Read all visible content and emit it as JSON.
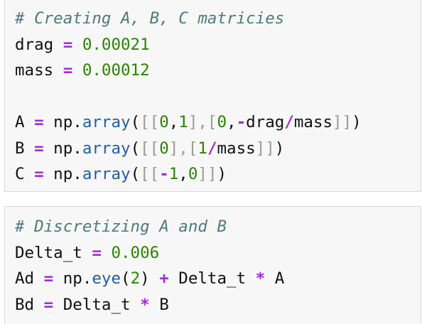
{
  "cells": [
    {
      "lines": [
        [
          {
            "t": "# Creating A, B, C matricies",
            "k": "cm"
          }
        ],
        [
          {
            "t": "drag",
            "k": "tx"
          },
          {
            "t": " ",
            "k": "tx"
          },
          {
            "t": "=",
            "k": "op"
          },
          {
            "t": " ",
            "k": "tx"
          },
          {
            "t": "0.00021",
            "k": "num"
          }
        ],
        [
          {
            "t": "mass",
            "k": "tx"
          },
          {
            "t": " ",
            "k": "tx"
          },
          {
            "t": "=",
            "k": "op"
          },
          {
            "t": " ",
            "k": "tx"
          },
          {
            "t": "0.00012",
            "k": "num"
          }
        ],
        [],
        [
          {
            "t": "A",
            "k": "tx"
          },
          {
            "t": " ",
            "k": "tx"
          },
          {
            "t": "=",
            "k": "op"
          },
          {
            "t": " np.",
            "k": "tx"
          },
          {
            "t": "array",
            "k": "fn"
          },
          {
            "t": "(",
            "k": "tx"
          },
          {
            "t": "[[",
            "k": "br"
          },
          {
            "t": "0",
            "k": "num"
          },
          {
            "t": ",",
            "k": "tx"
          },
          {
            "t": "1",
            "k": "num"
          },
          {
            "t": "],[",
            "k": "br"
          },
          {
            "t": "0",
            "k": "num"
          },
          {
            "t": ",",
            "k": "tx"
          },
          {
            "t": "-",
            "k": "op"
          },
          {
            "t": "drag",
            "k": "tx"
          },
          {
            "t": "/",
            "k": "op"
          },
          {
            "t": "mass",
            "k": "tx"
          },
          {
            "t": "]]",
            "k": "br"
          },
          {
            "t": ")",
            "k": "tx"
          }
        ],
        [
          {
            "t": "B",
            "k": "tx"
          },
          {
            "t": " ",
            "k": "tx"
          },
          {
            "t": "=",
            "k": "op"
          },
          {
            "t": " np.",
            "k": "tx"
          },
          {
            "t": "array",
            "k": "fn"
          },
          {
            "t": "(",
            "k": "tx"
          },
          {
            "t": "[[",
            "k": "br"
          },
          {
            "t": "0",
            "k": "num"
          },
          {
            "t": "],[",
            "k": "br"
          },
          {
            "t": "1",
            "k": "num"
          },
          {
            "t": "/",
            "k": "op"
          },
          {
            "t": "mass",
            "k": "tx"
          },
          {
            "t": "]]",
            "k": "br"
          },
          {
            "t": ")",
            "k": "tx"
          }
        ],
        [
          {
            "t": "C",
            "k": "tx"
          },
          {
            "t": " ",
            "k": "tx"
          },
          {
            "t": "=",
            "k": "op"
          },
          {
            "t": " np.",
            "k": "tx"
          },
          {
            "t": "array",
            "k": "fn"
          },
          {
            "t": "(",
            "k": "tx"
          },
          {
            "t": "[[",
            "k": "br"
          },
          {
            "t": "-",
            "k": "op"
          },
          {
            "t": "1",
            "k": "num"
          },
          {
            "t": ",",
            "k": "tx"
          },
          {
            "t": "0",
            "k": "num"
          },
          {
            "t": "]]",
            "k": "br"
          },
          {
            "t": ")",
            "k": "tx"
          }
        ]
      ]
    },
    {
      "lines": [
        [
          {
            "t": "# Discretizing A and B",
            "k": "cm"
          }
        ],
        [
          {
            "t": "Delta_t",
            "k": "tx"
          },
          {
            "t": " ",
            "k": "tx"
          },
          {
            "t": "=",
            "k": "op"
          },
          {
            "t": " ",
            "k": "tx"
          },
          {
            "t": "0.006",
            "k": "num"
          }
        ],
        [
          {
            "t": "Ad",
            "k": "tx"
          },
          {
            "t": " ",
            "k": "tx"
          },
          {
            "t": "=",
            "k": "op"
          },
          {
            "t": " np.",
            "k": "tx"
          },
          {
            "t": "eye",
            "k": "fn"
          },
          {
            "t": "(",
            "k": "tx"
          },
          {
            "t": "2",
            "k": "num"
          },
          {
            "t": ") ",
            "k": "tx"
          },
          {
            "t": "+",
            "k": "op"
          },
          {
            "t": " Delta_t ",
            "k": "tx"
          },
          {
            "t": "*",
            "k": "op"
          },
          {
            "t": " A",
            "k": "tx"
          }
        ],
        [
          {
            "t": "Bd",
            "k": "tx"
          },
          {
            "t": " ",
            "k": "tx"
          },
          {
            "t": "=",
            "k": "op"
          },
          {
            "t": " Delta_t ",
            "k": "tx"
          },
          {
            "t": "*",
            "k": "op"
          },
          {
            "t": " B",
            "k": "tx"
          }
        ]
      ]
    }
  ]
}
